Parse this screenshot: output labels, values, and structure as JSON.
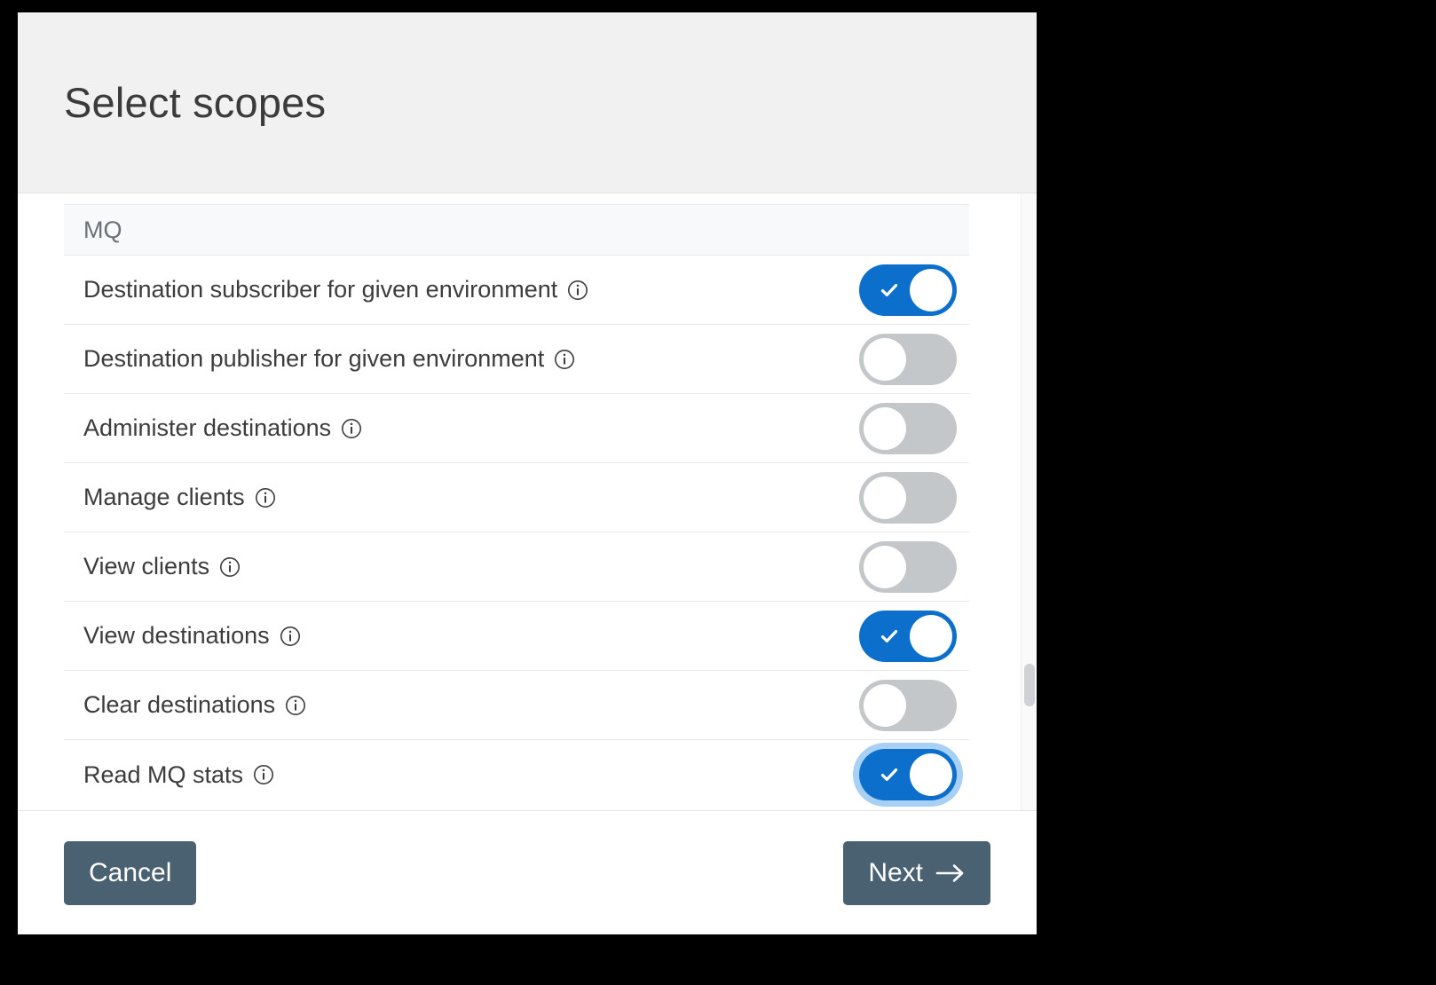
{
  "dialog": {
    "title": "Select scopes"
  },
  "group": {
    "label": "MQ"
  },
  "scopes": [
    {
      "label": "Destination subscriber for given environment",
      "info_icon": "info-circle-icon",
      "enabled": true,
      "focused": false
    },
    {
      "label": "Destination publisher for given environment",
      "info_icon": "info-circle-icon",
      "enabled": false,
      "focused": false
    },
    {
      "label": "Administer destinations",
      "info_icon": "info-circle-icon",
      "enabled": false,
      "focused": false
    },
    {
      "label": "Manage clients",
      "info_icon": "info-circle-icon",
      "enabled": false,
      "focused": false
    },
    {
      "label": "View clients",
      "info_icon": "info-circle-icon",
      "enabled": false,
      "focused": false
    },
    {
      "label": "View destinations",
      "info_icon": "info-circle-icon",
      "enabled": true,
      "focused": false
    },
    {
      "label": "Clear destinations",
      "info_icon": "info-circle-icon",
      "enabled": false,
      "focused": false
    },
    {
      "label": "Read MQ stats",
      "info_icon": "info-circle-icon",
      "enabled": true,
      "focused": true
    }
  ],
  "footer": {
    "cancel_label": "Cancel",
    "next_label": "Next",
    "next_icon": "arrow-right-icon"
  },
  "colors": {
    "toggle_on": "#0b6fcb",
    "toggle_off": "#c4c7c9",
    "focus_ring": "#a8d0f5",
    "button": "#4a6172",
    "header_bg": "#f1f1f1",
    "group_bg": "#f8f9fa",
    "backdrop": "#000000"
  },
  "scrollbar": {
    "orientation": "vertical",
    "thumb_position_pct": 72
  }
}
